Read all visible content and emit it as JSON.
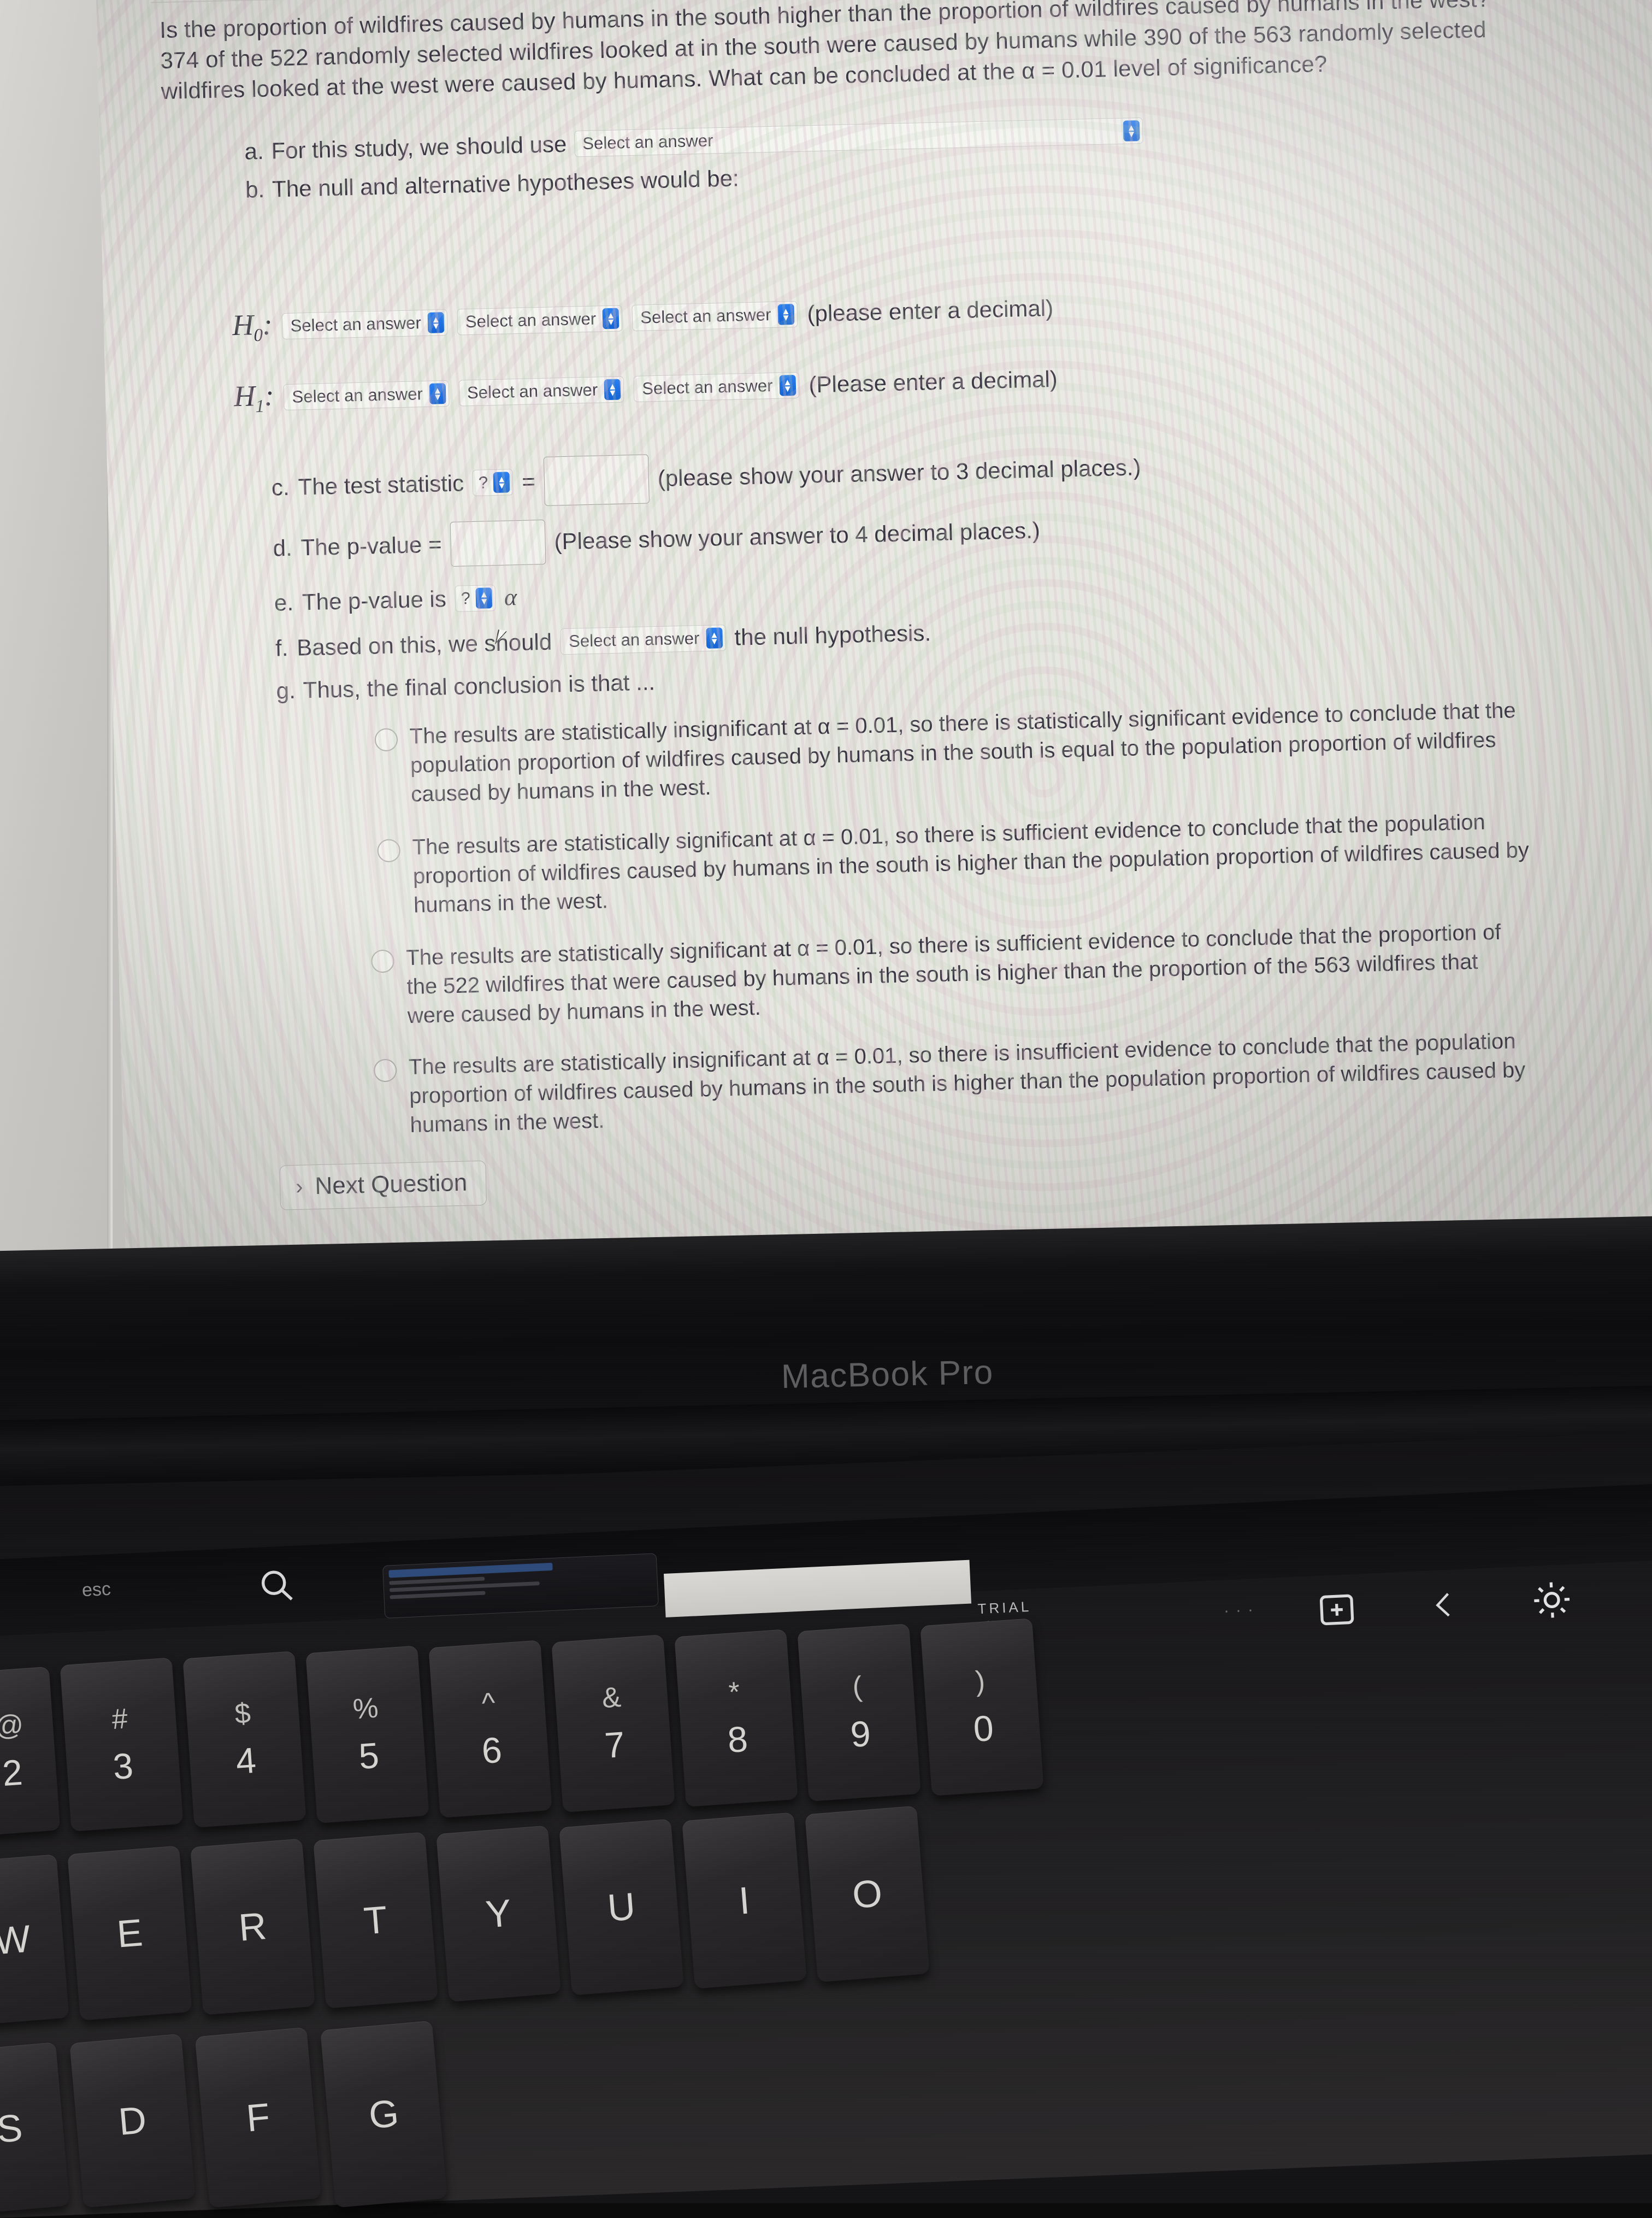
{
  "question": {
    "text": "Is the proportion of wildfires caused by humans in the south higher than the proportion of wildfires caused by humans in the west? 374 of the 522 randomly selected wildfires looked at in the south were caused by humans while 390 of the 563 randomly selected wildfires looked at the west were caused by humans. What can be concluded at the α = 0.01 level of significance?"
  },
  "items": {
    "a_marker": "a.",
    "a_label": "For this study, we should use",
    "b_marker": "b.",
    "b_label": "The null and alternative hypotheses would be:",
    "c_marker": "c.",
    "c_label": "The test statistic",
    "c_equals": "=",
    "c_note": "(please show your answer to 3 decimal places.)",
    "d_marker": "d.",
    "d_label": "The p-value =",
    "d_note": "(Please show your answer to 4 decimal places.)",
    "e_marker": "e.",
    "e_label": "The p-value is",
    "e_alpha": "α",
    "f_marker": "f.",
    "f_label": "Based on this, we should",
    "f_tail": "the null hypothesis.",
    "g_marker": "g.",
    "g_label": "Thus, the final conclusion is that ..."
  },
  "dropdown": {
    "placeholder": "Select an answer",
    "question_mark": "?",
    "arrow_up": "▴",
    "arrow_down": "▾",
    "accent_color": "#1c6fe0"
  },
  "hypotheses": {
    "h0_label": "H",
    "h0_sub": "0",
    "h0_colon": ":",
    "h0_note": "(please enter a decimal)",
    "h1_label": "H",
    "h1_sub": "1",
    "h1_colon": ":",
    "h1_note": "(Please enter a decimal)"
  },
  "conclusion_options": [
    "The results are statistically insignificant at α = 0.01, so there is statistically significant evidence to conclude that the population proportion of wildfires caused by humans in the south is equal to the population proportion of wildfires caused by humans in the west.",
    "The results are statistically significant at α = 0.01, so there is sufficient evidence to conclude that the population proportion of wildfires caused by humans in the south is higher than the population proportion of wildfires caused by humans in the west.",
    "The results are statistically significant at α = 0.01, so there is sufficient evidence to conclude that the proportion of the 522 wildfires that were caused by humans in the south is higher than the proportion of the 563 wildfires that were caused by humans in the west.",
    "The results are statistically insignificant at α = 0.01, so there is insufficient evidence to conclude that the population proportion of wildfires caused by humans in the south is higher than the population proportion of wildfires caused by humans in the west."
  ],
  "next_button": {
    "chevron": "›",
    "label": "Next Question"
  },
  "laptop": {
    "brand": "MacBook Pro",
    "touchbar": {
      "esc": "esc",
      "search_icon": "search-icon",
      "trial_line1": "TRIAL",
      "trial_line2": "•• • • •",
      "dots": "···",
      "screenshot_icon": "screenshot-icon",
      "back_icon": "chevron-left-icon",
      "brightness_icon": "brightness-icon"
    },
    "keyboard": {
      "number_row": [
        {
          "upper": "@",
          "lower": "2"
        },
        {
          "upper": "#",
          "lower": "3"
        },
        {
          "upper": "$",
          "lower": "4"
        },
        {
          "upper": "%",
          "lower": "5"
        },
        {
          "upper": "^",
          "lower": "6"
        },
        {
          "upper": "&",
          "lower": "7"
        },
        {
          "upper": "*",
          "lower": "8"
        },
        {
          "upper": "(",
          "lower": "9"
        },
        {
          "upper": ")",
          "lower": "0"
        }
      ],
      "letter_row": [
        "W",
        "E",
        "R",
        "T",
        "Y",
        "U",
        "I",
        "O"
      ],
      "bottom_row": [
        "S",
        "D",
        "F",
        "G"
      ]
    }
  }
}
